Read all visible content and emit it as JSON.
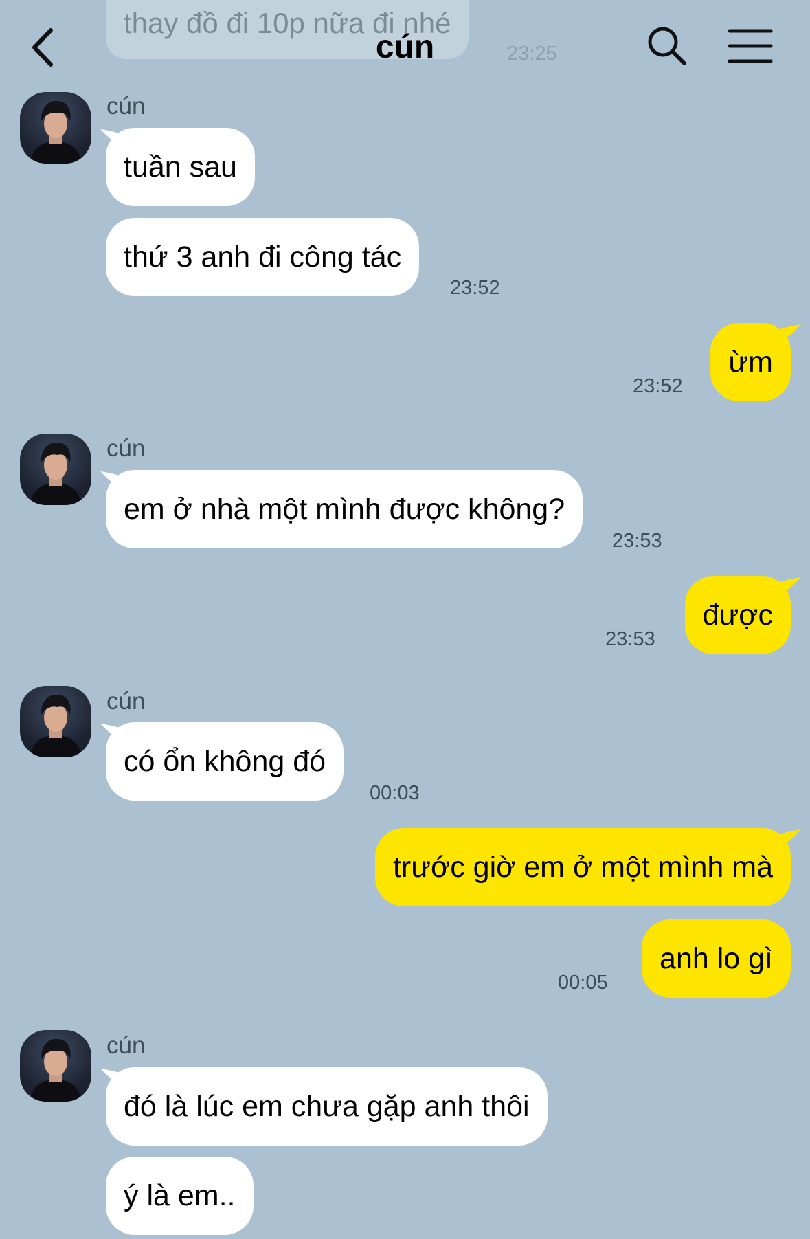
{
  "header": {
    "title": "cún",
    "back_icon": "chevron-left-icon",
    "search_icon": "search-icon",
    "menu_icon": "hamburger-menu-icon"
  },
  "faded_message": {
    "text": "thay đồ đi 10p nữa đi nhé",
    "time": "23:25"
  },
  "colors": {
    "background": "#abc1d1",
    "incoming_bubble": "#ffffff",
    "outgoing_bubble": "#fee500"
  },
  "groups": [
    {
      "sender": "cún",
      "messages": [
        "tuần sau",
        "thứ 3 anh đi công tác"
      ],
      "time": "23:52"
    },
    {
      "outgoing": true,
      "messages": [
        "ừm"
      ],
      "time": "23:52"
    },
    {
      "sender": "cún",
      "messages": [
        "em ở nhà một mình được không?"
      ],
      "time": "23:53"
    },
    {
      "outgoing": true,
      "messages": [
        "được"
      ],
      "time": "23:53"
    },
    {
      "sender": "cún",
      "messages": [
        "có ổn không đó"
      ],
      "time": "00:03"
    },
    {
      "outgoing": true,
      "messages": [
        "trước giờ em ở một mình mà",
        "anh lo gì"
      ],
      "time": "00:05"
    },
    {
      "sender": "cún",
      "messages": [
        "đó là lúc em chưa gặp anh thôi",
        "ý là em.."
      ]
    }
  ]
}
